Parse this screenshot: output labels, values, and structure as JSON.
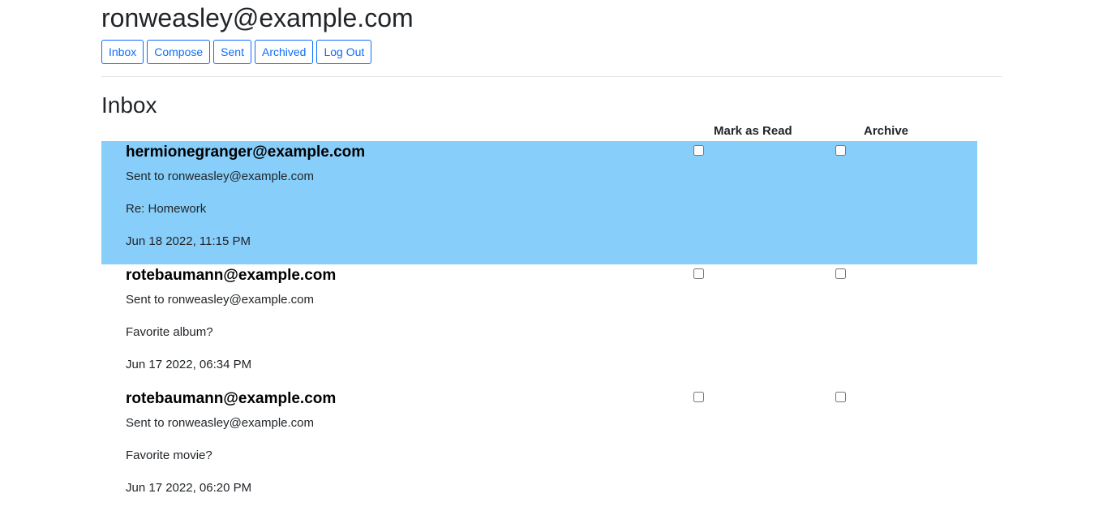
{
  "header": {
    "user_email": "ronweasley@example.com"
  },
  "nav": {
    "inbox": "Inbox",
    "compose": "Compose",
    "sent": "Sent",
    "archived": "Archived",
    "logout": "Log Out"
  },
  "mailbox": {
    "title": "Inbox",
    "col_mark_read": "Mark as Read",
    "col_archive": "Archive"
  },
  "emails": [
    {
      "sender": "hermionegranger@example.com",
      "recipients": "Sent to ronweasley@example.com",
      "subject": "Re: Homework",
      "timestamp": "Jun 18 2022, 11:15 PM",
      "unread": true,
      "row_color": "#87cefa"
    },
    {
      "sender": "rotebaumann@example.com",
      "recipients": "Sent to ronweasley@example.com",
      "subject": "Favorite album?",
      "timestamp": "Jun 17 2022, 06:34 PM",
      "unread": false
    },
    {
      "sender": "rotebaumann@example.com",
      "recipients": "Sent to ronweasley@example.com",
      "subject": "Favorite movie?",
      "timestamp": "Jun 17 2022, 06:20 PM",
      "unread": false
    }
  ],
  "colors": {
    "accent": "#0d6efd",
    "unread_background": "#87cefa",
    "text": "#212529"
  }
}
